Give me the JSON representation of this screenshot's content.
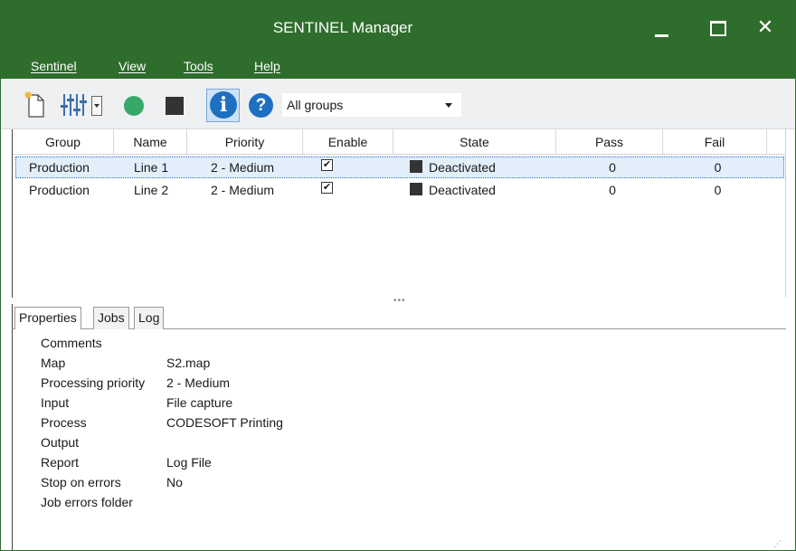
{
  "window": {
    "title": "SENTINEL Manager"
  },
  "menu": {
    "items": [
      "Sentinel",
      "View",
      "Tools",
      "Help"
    ]
  },
  "toolbar": {
    "group_filter": "All groups",
    "icons": [
      "new-document-icon",
      "mixer-settings-icon",
      "run-icon",
      "stop-icon",
      "info-icon",
      "help-icon"
    ],
    "info_label": "i",
    "help_label": "?"
  },
  "grid": {
    "columns": [
      "Group",
      "Name",
      "Priority",
      "Enable",
      "State",
      "Pass",
      "Fail"
    ],
    "rows": [
      {
        "group": "Production",
        "name": "Line 1",
        "priority": "2 - Medium",
        "enable": "✔",
        "state": "Deactivated",
        "pass": "0",
        "fail": "0",
        "selected": true
      },
      {
        "group": "Production",
        "name": "Line 2",
        "priority": "2 - Medium",
        "enable": "✔",
        "state": "Deactivated",
        "pass": "0",
        "fail": "0",
        "selected": false
      }
    ]
  },
  "tabs": [
    {
      "label": "Properties",
      "active": true
    },
    {
      "label": "Jobs",
      "active": false
    },
    {
      "label": "Log",
      "active": false
    }
  ],
  "properties": [
    {
      "label": "Comments",
      "value": ""
    },
    {
      "label": "Map",
      "value": "S2.map"
    },
    {
      "label": "Processing priority",
      "value": "2 - Medium"
    },
    {
      "label": "Input",
      "value": "File capture"
    },
    {
      "label": "Process",
      "value": "CODESOFT Printing"
    },
    {
      "label": "Output",
      "value": ""
    },
    {
      "label": "Report",
      "value": "Log File"
    },
    {
      "label": "Stop on errors",
      "value": "No"
    },
    {
      "label": "Job errors folder",
      "value": ""
    }
  ],
  "colors": {
    "chrome": "#2f6d2c",
    "run": "#37a86a",
    "stop": "#333333",
    "info": "#1f6fc1",
    "selection": "#e3eefb"
  }
}
